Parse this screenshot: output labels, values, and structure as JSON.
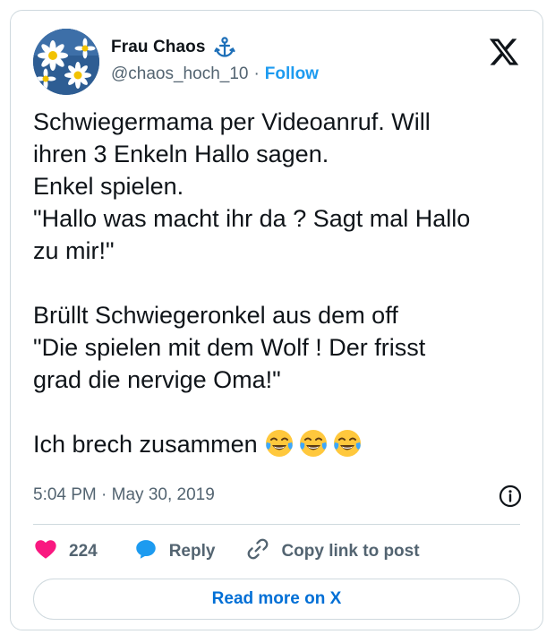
{
  "author": {
    "name": "Frau Chaos",
    "handle": "@chaos_hoch_10",
    "separator": "·",
    "follow_label": "Follow",
    "badge_icon": "anchor-icon"
  },
  "tweet": {
    "text": "Schwiegermama per Videoanruf. Will\nihren 3 Enkeln Hallo sagen.\nEnkel spielen.\n\"Hallo was macht ihr da ? Sagt mal Hallo\nzu mir!\"\n\nBrüllt Schwiegeronkel aus dem off\n\"Die spielen mit dem Wolf ! Der frisst\ngrad die nervige Oma!\"\n\nIch brech zusammen ",
    "emojis": [
      "face-with-tears-of-joy",
      "face-with-tears-of-joy",
      "face-with-tears-of-joy"
    ],
    "timestamp": "5:04 PM · May 30, 2019"
  },
  "actions": {
    "like_count": "224",
    "reply_label": "Reply",
    "copy_label": "Copy link to post"
  },
  "read_more_label": "Read more on X",
  "colors": {
    "accent": "#1d9bf0",
    "link": "#006fd6",
    "like": "#f91880",
    "secondary_text": "#536471",
    "border": "#cfd9de"
  }
}
